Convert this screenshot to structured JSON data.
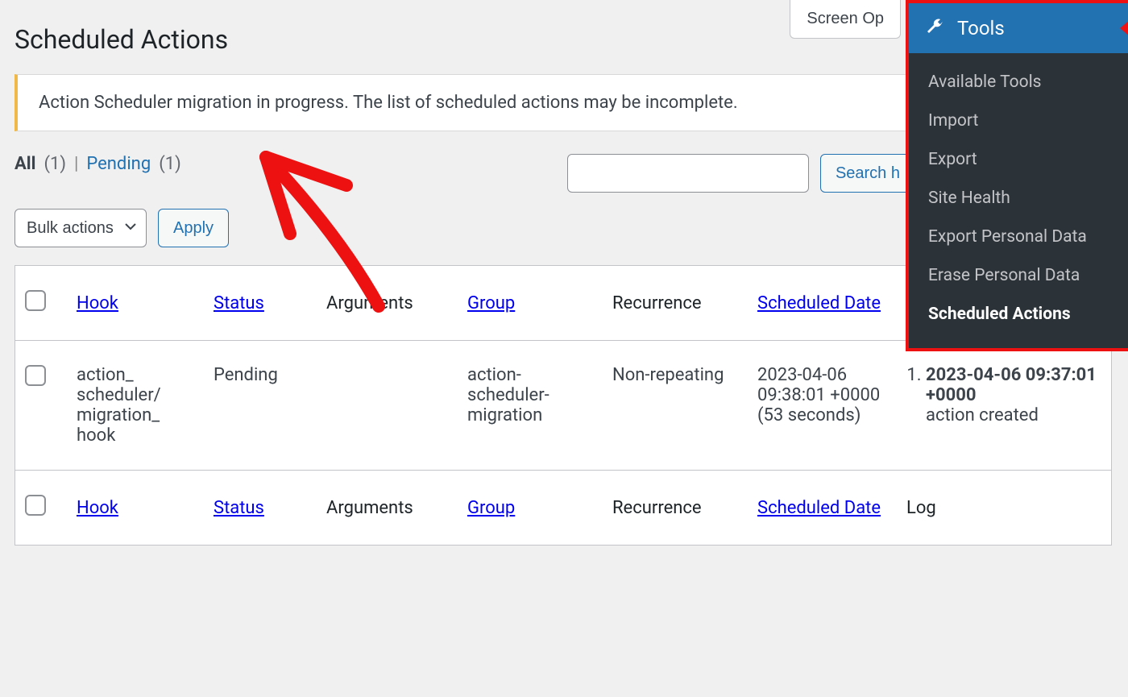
{
  "header": {
    "title": "Scheduled Actions"
  },
  "screen_options": {
    "label": "Screen Op"
  },
  "notice": {
    "text": "Action Scheduler migration in progress. The list of scheduled actions may be incomplete."
  },
  "filters": {
    "all_label": "All",
    "all_count": "(1)",
    "pending_label": "Pending",
    "pending_count": "(1)",
    "divider": "|"
  },
  "search": {
    "placeholder": "",
    "button_label": "Search h"
  },
  "bulk": {
    "select_label": "Bulk actions",
    "apply_label": "Apply"
  },
  "table": {
    "columns": {
      "hook": "Hook",
      "status": "Status",
      "args": "Arguments",
      "group": "Group",
      "recurrence": "Recurrence",
      "scheduled": "Scheduled Date",
      "log": "Log"
    },
    "rows": [
      {
        "hook": "action_scheduler/migration_hook",
        "status": "Pending",
        "args": "",
        "group": "action-scheduler-migration",
        "recurrence": "Non-repeating",
        "scheduled": "2023-04-06 09:38:01 +0000\n(53 seconds)",
        "log": [
          {
            "ts": "2023-04-06 09:37:01 +0000",
            "msg": "action created"
          }
        ]
      }
    ]
  },
  "tools_menu": {
    "title": "Tools",
    "items": [
      "Available Tools",
      "Import",
      "Export",
      "Site Health",
      "Export Personal Data",
      "Erase Personal Data",
      "Scheduled Actions"
    ],
    "current": "Scheduled Actions"
  }
}
